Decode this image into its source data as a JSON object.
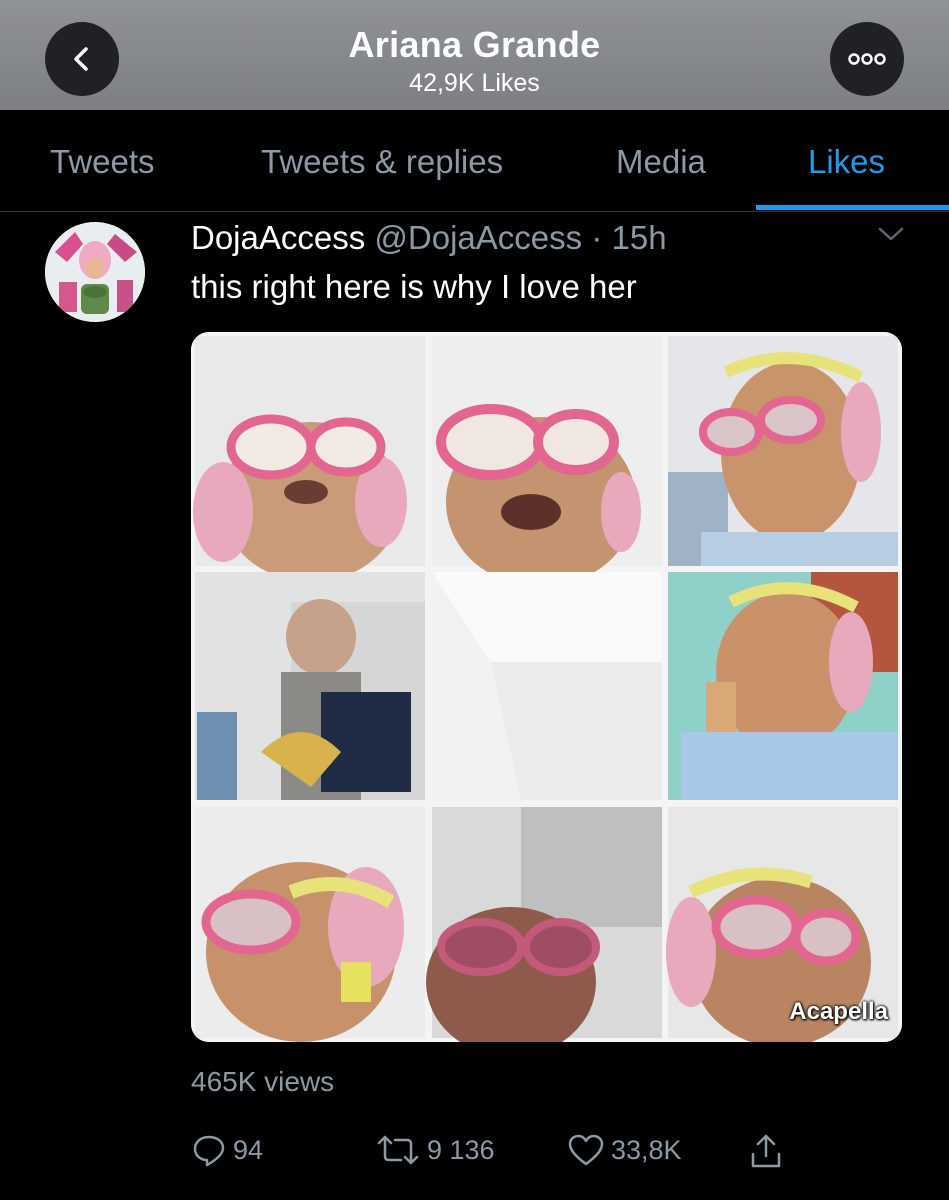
{
  "header": {
    "title": "Ariana Grande",
    "subtitle": "42,9K Likes",
    "back_icon": "chevron-left-icon",
    "more_icon": "ellipsis-icon"
  },
  "tabs": [
    {
      "label": "Tweets",
      "active": false
    },
    {
      "label": "Tweets & replies",
      "active": false
    },
    {
      "label": "Media",
      "active": false
    },
    {
      "label": "Likes",
      "active": true
    }
  ],
  "tweet": {
    "display_name": "DojaAccess",
    "handle": "@DojaAccess",
    "separator": "·",
    "time": "15h",
    "text": "this right here is why I love her",
    "media_overlay": "Acapella",
    "views": "465K views",
    "actions": {
      "reply_count": "94",
      "retweet_count": "9 136",
      "like_count": "33,8K"
    }
  },
  "colors": {
    "accent": "#1d9bf0",
    "muted": "#8b98a5",
    "header_bg": "#86898e"
  }
}
